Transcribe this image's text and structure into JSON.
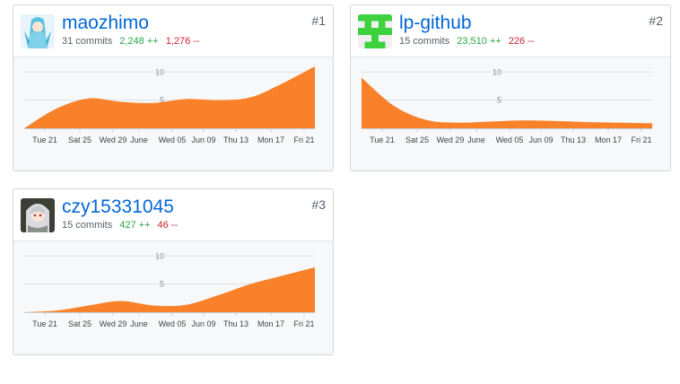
{
  "contributors": [
    {
      "username": "maozhimo",
      "commits_text": "31 commits",
      "additions_text": "2,248 ++",
      "deletions_text": "1,276 --",
      "rank_text": "#1"
    },
    {
      "username": "lp-github",
      "commits_text": "15 commits",
      "additions_text": "23,510 ++",
      "deletions_text": "226 --",
      "rank_text": "#2"
    },
    {
      "username": "czy15331045",
      "commits_text": "15 commits",
      "additions_text": "427 ++",
      "deletions_text": "46 --",
      "rank_text": "#3"
    }
  ],
  "colors": {
    "area": "#f9812a",
    "link": "#0366d6",
    "additions": "#28a745",
    "deletions": "#cb2431"
  },
  "chart_data": [
    {
      "type": "area",
      "x_tick_labels": [
        "Tue 21",
        "Sat 25",
        "Wed 29",
        "June",
        "Wed 05",
        "Jun 09",
        "Thu 13",
        "Mon 17",
        "Fri 21"
      ],
      "y_tick_labels": [
        "5",
        "10"
      ],
      "ylim": [
        0,
        11
      ],
      "values": [
        0,
        3.5,
        5.3,
        4.7,
        4.5,
        5.2,
        5.0,
        5.5,
        8.0,
        11.0
      ],
      "grid": true
    },
    {
      "type": "area",
      "x_tick_labels": [
        "Tue 21",
        "Sat 25",
        "Wed 29",
        "June",
        "Wed 05",
        "Jun 09",
        "Thu 13",
        "Mon 17",
        "Fri 21"
      ],
      "y_tick_labels": [
        "5",
        "10"
      ],
      "ylim": [
        0,
        11
      ],
      "values": [
        9.0,
        4.0,
        1.5,
        1.0,
        1.2,
        1.4,
        1.3,
        1.1,
        1.0,
        0.9
      ],
      "grid": true
    },
    {
      "type": "area",
      "x_tick_labels": [
        "Tue 21",
        "Sat 25",
        "Wed 29",
        "June",
        "Wed 05",
        "Jun 09",
        "Thu 13",
        "Mon 17",
        "Fri 21"
      ],
      "y_tick_labels": [
        "5",
        "10"
      ],
      "ylim": [
        0,
        11
      ],
      "values": [
        0,
        0.3,
        1.2,
        2.0,
        1.2,
        1.3,
        3.0,
        5.0,
        6.5,
        8.0
      ],
      "grid": true
    }
  ]
}
